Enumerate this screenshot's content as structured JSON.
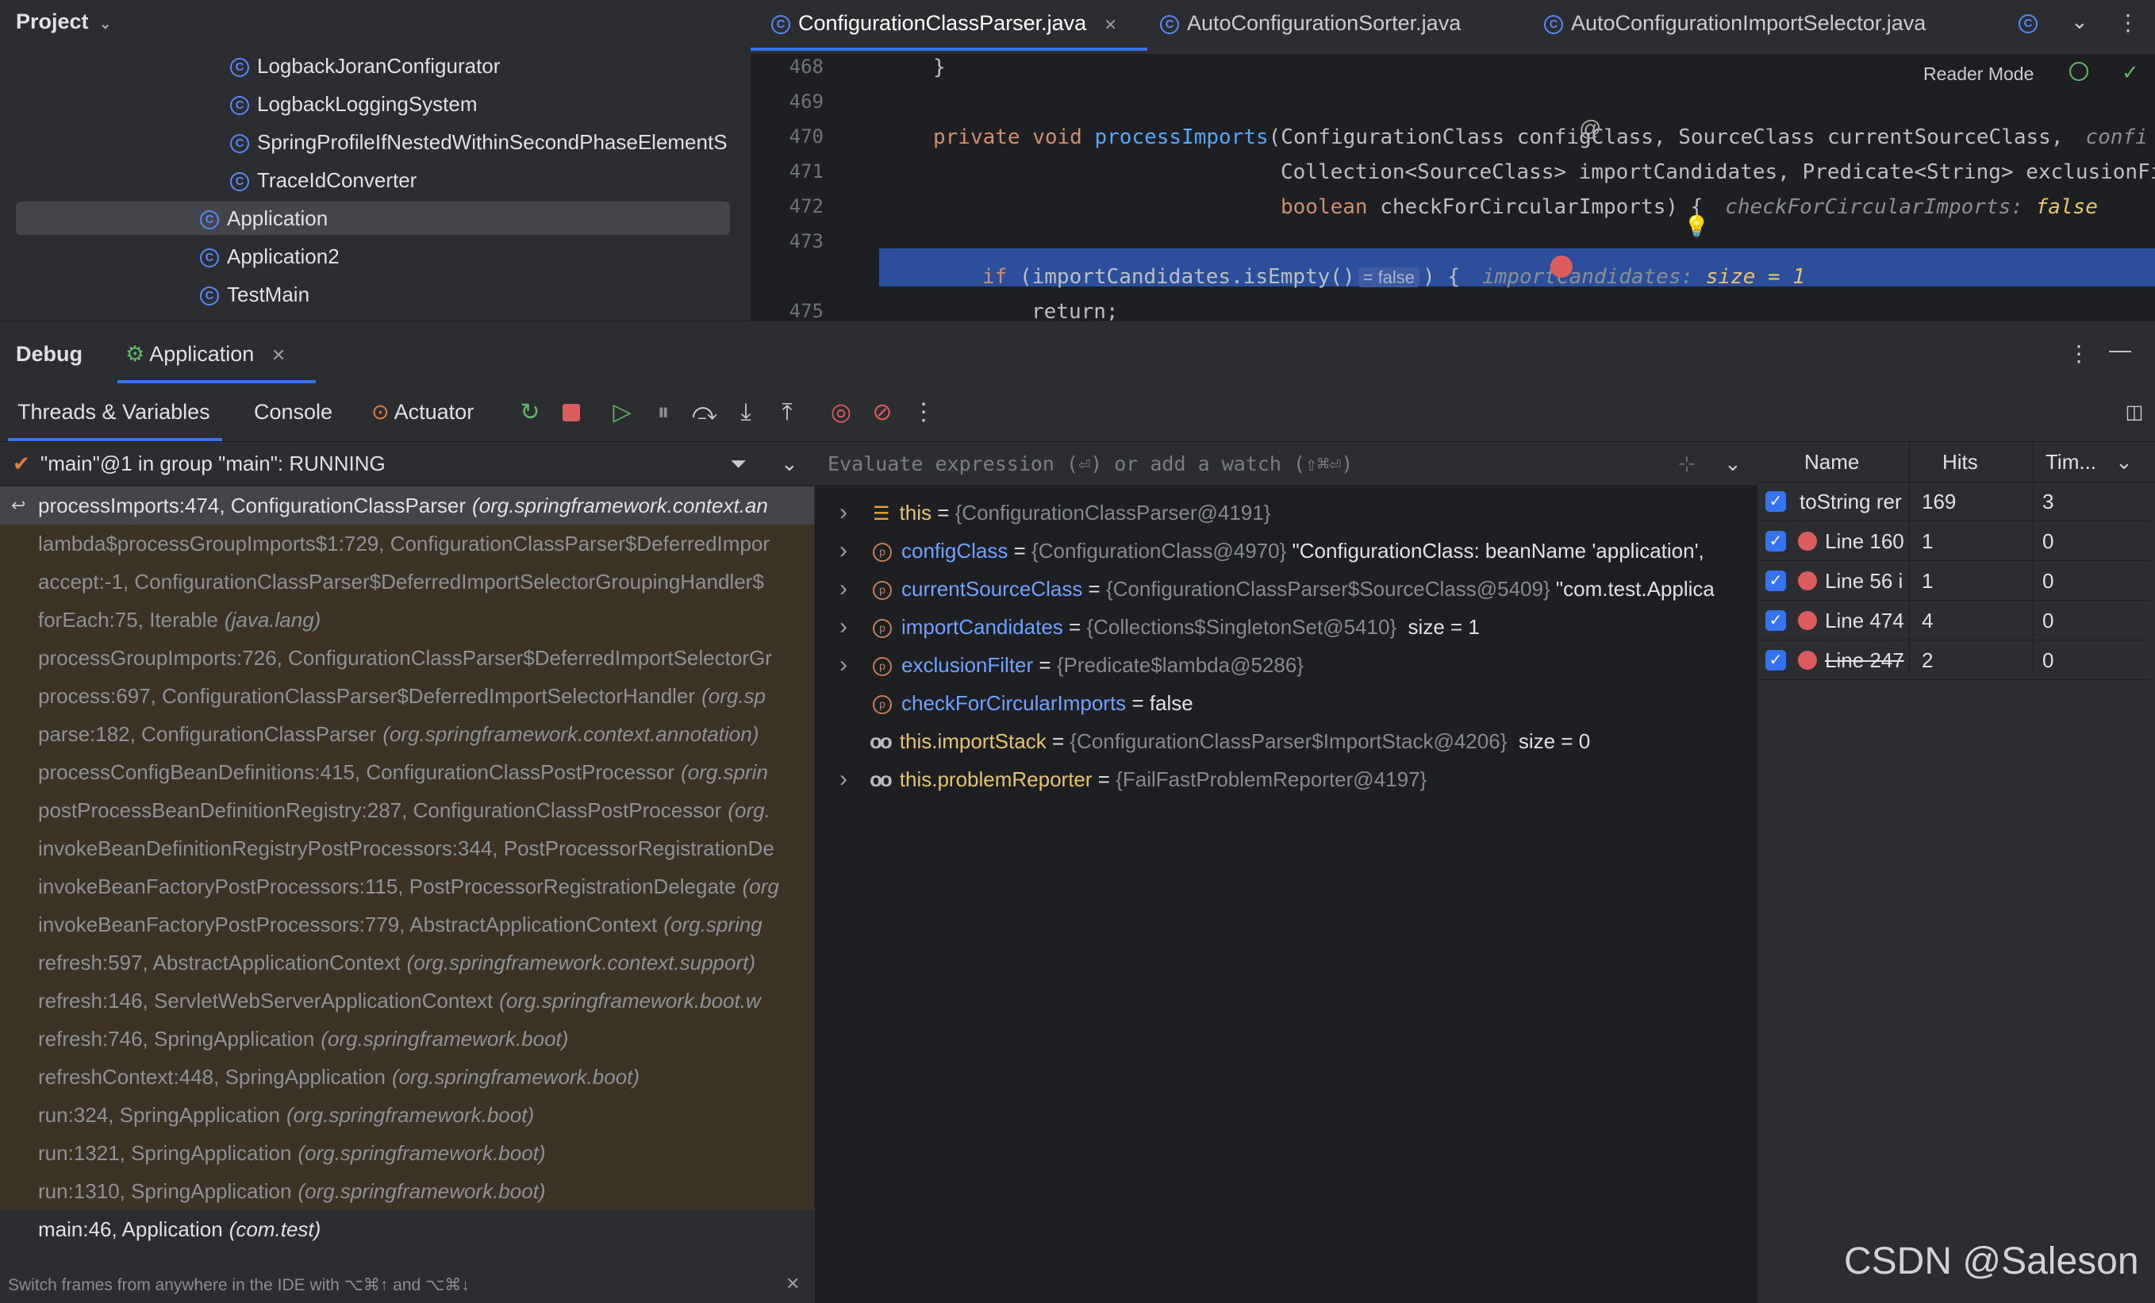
{
  "project": {
    "title": "Project",
    "tree": [
      {
        "label": "LogbackJoranConfigurator",
        "indent": 1
      },
      {
        "label": "LogbackLoggingSystem",
        "indent": 1
      },
      {
        "label": "SpringProfileIfNestedWithinSecondPhaseElementS",
        "indent": 1
      },
      {
        "label": "TraceIdConverter",
        "indent": 1
      },
      {
        "label": "Application",
        "indent": 0,
        "selected": true
      },
      {
        "label": "Application2",
        "indent": 0
      },
      {
        "label": "TestMain",
        "indent": 0
      }
    ]
  },
  "editor": {
    "tabs": [
      {
        "label": "ConfigurationClassParser.java",
        "active": true
      },
      {
        "label": "AutoConfigurationSorter.java",
        "active": false
      },
      {
        "label": "AutoConfigurationImportSelector.java",
        "active": false
      }
    ],
    "reader_mode": "Reader Mode",
    "lines": [
      {
        "num": "468",
        "code": "}"
      },
      {
        "num": "469",
        "code": ""
      },
      {
        "num": "470",
        "code_kw": "private void ",
        "code_fn": "processImports",
        "code_rest": "(ConfigurationClass configClass, SourceClass currentSourceClass,",
        "hint": "confi"
      },
      {
        "num": "471",
        "code": "Collection<SourceClass> importCandidates, Predicate<String> exclusionFi"
      },
      {
        "num": "472",
        "code_kw": "boolean ",
        "code_rest": "checkForCircularImports) {",
        "hint": "checkForCircularImports: ",
        "hint_val": "false"
      },
      {
        "num": "473",
        "code": ""
      },
      {
        "num": "",
        "code_kw": "if ",
        "code_rest": "(importCandidates.isEmpty()",
        "inline_hint": "= false",
        "code_tail": ") {",
        "hint": "importCandidates: ",
        "hint_val": "size = 1"
      },
      {
        "num": "475",
        "code": "return;"
      }
    ]
  },
  "debug": {
    "title": "Debug",
    "session_tab": "Application",
    "tabs": [
      "Threads & Variables",
      "Console",
      "Actuator"
    ],
    "thread": "\"main\"@1 in group \"main\": RUNNING",
    "frames": [
      {
        "method": "processImports:474, ConfigurationClassParser",
        "pkg": "(org.springframework.context.an",
        "current": true
      },
      {
        "method": "lambda$processGroupImports$1:729, ConfigurationClassParser$DeferredImpor",
        "pkg": ""
      },
      {
        "method": "accept:-1, ConfigurationClassParser$DeferredImportSelectorGroupingHandler$",
        "pkg": ""
      },
      {
        "method": "forEach:75, Iterable",
        "pkg": "(java.lang)"
      },
      {
        "method": "processGroupImports:726, ConfigurationClassParser$DeferredImportSelectorGr",
        "pkg": ""
      },
      {
        "method": "process:697, ConfigurationClassParser$DeferredImportSelectorHandler",
        "pkg": "(org.sp"
      },
      {
        "method": "parse:182, ConfigurationClassParser",
        "pkg": "(org.springframework.context.annotation)"
      },
      {
        "method": "processConfigBeanDefinitions:415, ConfigurationClassPostProcessor",
        "pkg": "(org.sprin"
      },
      {
        "method": "postProcessBeanDefinitionRegistry:287, ConfigurationClassPostProcessor",
        "pkg": "(org."
      },
      {
        "method": "invokeBeanDefinitionRegistryPostProcessors:344, PostProcessorRegistrationDe",
        "pkg": ""
      },
      {
        "method": "invokeBeanFactoryPostProcessors:115, PostProcessorRegistrationDelegate",
        "pkg": "(org"
      },
      {
        "method": "invokeBeanFactoryPostProcessors:779, AbstractApplicationContext",
        "pkg": "(org.spring"
      },
      {
        "method": "refresh:597, AbstractApplicationContext",
        "pkg": "(org.springframework.context.support)"
      },
      {
        "method": "refresh:146, ServletWebServerApplicationContext",
        "pkg": "(org.springframework.boot.w"
      },
      {
        "method": "refresh:746, SpringApplication",
        "pkg": "(org.springframework.boot)"
      },
      {
        "method": "refreshContext:448, SpringApplication",
        "pkg": "(org.springframework.boot)"
      },
      {
        "method": "run:324, SpringApplication",
        "pkg": "(org.springframework.boot)"
      },
      {
        "method": "run:1321, SpringApplication",
        "pkg": "(org.springframework.boot)"
      },
      {
        "method": "run:1310, SpringApplication",
        "pkg": "(org.springframework.boot)"
      },
      {
        "method": "main:46, Application",
        "pkg": "(com.test)",
        "plain": true
      }
    ],
    "frames_hint": "Switch frames from anywhere in the IDE with ⌥⌘↑ and ⌥⌘↓",
    "eval_placeholder": "Evaluate expression (⏎) or add a watch (⇧⌘⏎)",
    "variables": [
      {
        "name": "this",
        "eq": " = ",
        "ref": "{ConfigurationClassParser@4191}",
        "value": "",
        "icon": "field-icon",
        "expand": true
      },
      {
        "name": "configClass",
        "eq": " = ",
        "ref": "{ConfigurationClass@4970}",
        "value": " \"ConfigurationClass: beanName 'application',",
        "icon": "param-icon",
        "expand": true
      },
      {
        "name": "currentSourceClass",
        "eq": " = ",
        "ref": "{ConfigurationClassParser$SourceClass@5409}",
        "value": " \"com.test.Applica",
        "icon": "param-icon",
        "expand": true
      },
      {
        "name": "importCandidates",
        "eq": " = ",
        "ref": "{Collections$SingletonSet@5410}",
        "value": "  size = 1",
        "icon": "param-icon",
        "expand": true
      },
      {
        "name": "exclusionFilter",
        "eq": " = ",
        "ref": "{Predicate$lambda@5286}",
        "value": "",
        "icon": "param-icon",
        "expand": true
      },
      {
        "name": "checkForCircularImports",
        "eq": " = ",
        "ref": "",
        "value": "false",
        "icon": "param-icon",
        "expand": false
      },
      {
        "name": "this.importStack",
        "eq": " = ",
        "ref": "{ConfigurationClassParser$ImportStack@4206}",
        "value": "  size = 0",
        "icon": "watch-icon",
        "expand": false
      },
      {
        "name": "this.problemReporter",
        "eq": " = ",
        "ref": "{FailFastProblemReporter@4197}",
        "value": "",
        "icon": "watch-icon",
        "expand": true
      }
    ],
    "breakpoints": {
      "headers": [
        "Name",
        "Hits",
        "Tim..."
      ],
      "rows": [
        {
          "name": "toString rer",
          "hits": "169",
          "time": "3",
          "dot": false,
          "strike": false
        },
        {
          "name": "Line 160",
          "hits": "1",
          "time": "0",
          "dot": true,
          "strike": false
        },
        {
          "name": "Line 56 i",
          "hits": "1",
          "time": "0",
          "dot": true,
          "strike": false
        },
        {
          "name": "Line 474",
          "hits": "4",
          "time": "0",
          "dot": true,
          "strike": false
        },
        {
          "name": "Line 247",
          "hits": "2",
          "time": "0",
          "dot": true,
          "strike": true
        }
      ]
    }
  },
  "watermark": "CSDN @Saleson",
  "colors": {
    "accent": "#3574f0",
    "frame_bg": "#3c3324",
    "selected_line": "#2d4e9a",
    "breakpoint": "#db5c5c"
  }
}
